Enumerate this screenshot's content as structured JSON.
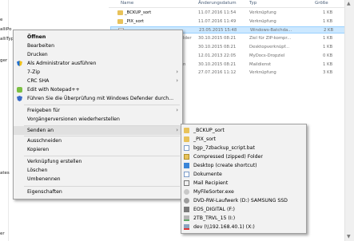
{
  "explorer": {
    "left_fragments": [
      "e",
      "alliPo",
      "alliTyp",
      "ger",
      "ates",
      "er"
    ],
    "columns": {
      "name": "Name",
      "date": "Änderungsdatum",
      "type": "Typ",
      "size": "Größe"
    },
    "files": [
      {
        "name": "_BCKUP_sort",
        "date": "11.07.2016 11:54",
        "type": "Verknüpfung",
        "size": "1 KB",
        "icon": "folder-shortcut-icon",
        "selected": false
      },
      {
        "name": "_PIX_sort",
        "date": "11.07.2016 11:49",
        "type": "Verknüpfung",
        "size": "1 KB",
        "icon": "folder-shortcut-icon",
        "selected": false
      },
      {
        "name": "",
        "date": "23.05.2015 15:48",
        "type": "Windows-Batchda...",
        "size": "2 KB",
        "icon": "batch-file-icon",
        "selected": true
      },
      {
        "name": "",
        "date": "30.10.2015 08:21",
        "type": "Ziel für ZIP-kompr...",
        "size": "1 KB",
        "icon": "",
        "selected": false
      },
      {
        "name": "",
        "date": "30.10.2015 08:21",
        "type": "Desktopverknüpf...",
        "size": "1 KB",
        "icon": "",
        "selected": false
      },
      {
        "name": "",
        "date": "12.01.2013 22:05",
        "type": "MyDocs-Dropziel",
        "size": "0 KB",
        "icon": "",
        "selected": false
      },
      {
        "name": "",
        "date": "30.10.2015 08:21",
        "type": "Maildienst",
        "size": "1 KB",
        "icon": "",
        "selected": false
      },
      {
        "name": "",
        "date": "27.07.2016 11:12",
        "type": "Verknüpfung",
        "size": "3 KB",
        "icon": "",
        "selected": false
      }
    ],
    "partial_words": [
      "lder",
      "n"
    ]
  },
  "context_menu": {
    "items": [
      {
        "label": "Öffnen",
        "bold": true,
        "icon": "",
        "arrow": false
      },
      {
        "label": "Bearbeiten",
        "bold": false,
        "icon": "",
        "arrow": false
      },
      {
        "label": "Drucken",
        "bold": false,
        "icon": "",
        "arrow": false
      },
      {
        "label": "Als Administrator ausführen",
        "bold": false,
        "icon": "uac-shield-icon",
        "arrow": false
      },
      {
        "label": "7-Zip",
        "bold": false,
        "icon": "",
        "arrow": true
      },
      {
        "label": "CRC SHA",
        "bold": false,
        "icon": "",
        "arrow": true
      },
      {
        "label": "Edit with Notepad++",
        "bold": false,
        "icon": "notepad-plus-plus-icon",
        "arrow": false
      },
      {
        "label": "Führen Sie die Überprüfung mit Windows Defender durch...",
        "bold": false,
        "icon": "windows-defender-icon",
        "arrow": false
      },
      {
        "label": "Freigeben für",
        "bold": false,
        "icon": "",
        "arrow": true
      },
      {
        "label": "Vorgängerversionen wiederherstellen",
        "bold": false,
        "icon": "",
        "arrow": false
      },
      {
        "label": "Senden an",
        "bold": false,
        "icon": "",
        "arrow": true
      },
      {
        "label": "Ausschneiden",
        "bold": false,
        "icon": "",
        "arrow": false
      },
      {
        "label": "Kopieren",
        "bold": false,
        "icon": "",
        "arrow": false
      },
      {
        "label": "Verknüpfung erstellen",
        "bold": false,
        "icon": "",
        "arrow": false
      },
      {
        "label": "Löschen",
        "bold": false,
        "icon": "",
        "arrow": false
      },
      {
        "label": "Umbenennen",
        "bold": false,
        "icon": "",
        "arrow": false
      },
      {
        "label": "Eigenschaften",
        "bold": false,
        "icon": "",
        "arrow": false
      }
    ]
  },
  "send_to_menu": {
    "items": [
      {
        "label": "_BCKUP_sort",
        "icon": "folder-icon"
      },
      {
        "label": "_PIX_sort",
        "icon": "folder-icon"
      },
      {
        "label": "bgp_7zbackup_script.bat",
        "icon": "batch-file-icon"
      },
      {
        "label": "Compressed (zipped) Folder",
        "icon": "zip-folder-icon"
      },
      {
        "label": "Desktop (create shortcut)",
        "icon": "desktop-icon"
      },
      {
        "label": "Dokumente",
        "icon": "documents-icon"
      },
      {
        "label": "Mail Recipient",
        "icon": "mail-icon"
      },
      {
        "label": "MyFileSorter.exe",
        "icon": "app-icon"
      },
      {
        "label": "DVD-RW-Laufwerk (D:) SAMSUNG SSD",
        "icon": "dvd-drive-icon"
      },
      {
        "label": "EOS_DIGITAL (F:)",
        "icon": "usb-drive-icon"
      },
      {
        "label": "2TB_TRVL_15 (I:)",
        "icon": "hard-drive-icon"
      },
      {
        "label": "dev (\\\\192.168.40.1) (X:)",
        "icon": "network-drive-icon"
      }
    ]
  }
}
